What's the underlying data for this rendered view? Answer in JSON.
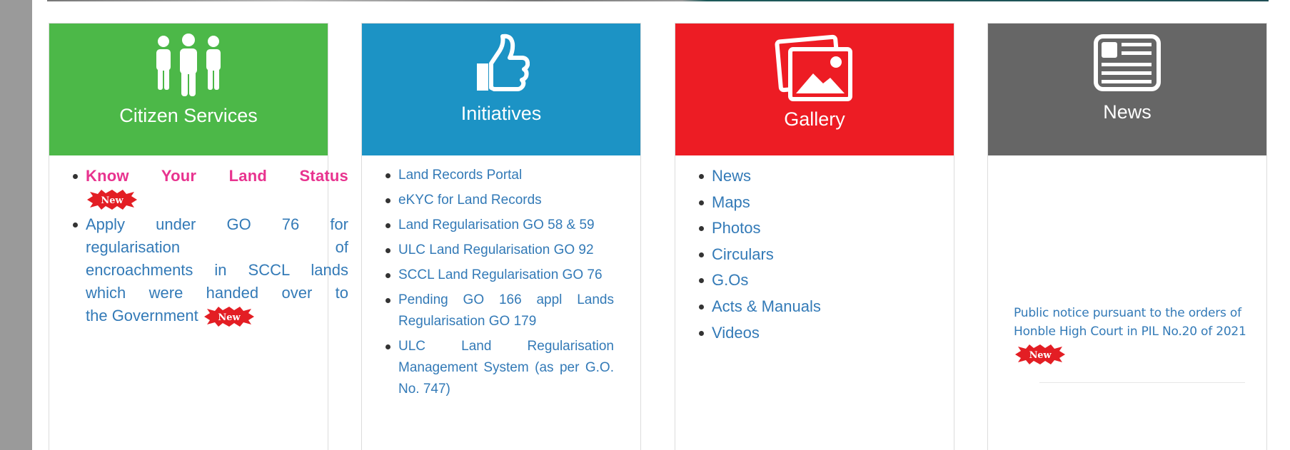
{
  "panels": {
    "citizen": {
      "title": "Citizen Services",
      "color": "#4cb848",
      "icon": "people-group-icon",
      "items": [
        {
          "label": "Know Your Land Status",
          "badge": "New"
        },
        {
          "label_lines": [
            "Apply under GO 76 for",
            "regularisation of",
            "encroachments in SCCL lands",
            "which were handed over to"
          ],
          "label_last": "the Government",
          "badge": "New"
        }
      ]
    },
    "initiatives": {
      "title": "Initiatives",
      "color": "#1c93c5",
      "icon": "thumbs-up-icon",
      "items": [
        "Land Records Portal",
        "eKYC for Land Records",
        "Land Regularisation GO 58 & 59",
        "ULC Land Regularisation GO 92",
        "SCCL Land Regularisation GO 76",
        "Pending GO 166 appl Lands Regularisation GO 179",
        "ULC Land Regularisation Management System (as per G.O. No. 747)"
      ]
    },
    "gallery": {
      "title": "Gallery",
      "color": "#ed1c24",
      "icon": "images-icon",
      "items": [
        "News",
        "Maps",
        "Photos",
        "Circulars",
        "G.Os",
        "Acts & Manuals",
        "Videos"
      ]
    },
    "news": {
      "title": "News",
      "color": "#666666",
      "icon": "newspaper-icon",
      "notice": "Public notice pursuant to the orders of Honble High Court in PIL No.20 of 2021",
      "badge": "New"
    }
  }
}
